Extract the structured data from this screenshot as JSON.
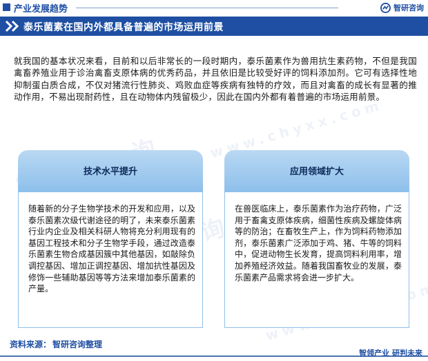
{
  "header": {
    "section_title": "产业发展趋势",
    "brand_name": "智研咨询"
  },
  "title_band": {
    "text": "泰乐菌素在国内外都具备普遍的市场运用前景"
  },
  "intro": {
    "text": "就我国的基本状况来看，目前和以后非常长的一段时期内，泰乐菌素作为兽用抗生素药物，不但是我国禽畜养殖业用于诊治禽畜支原体病的优秀药品，并且依旧是比较受好评的饲料添加剂。它可有选择性地抑制蛋白质合成，不仅对猪流行性肺炎、鸡败血症等疾病有独特的疗效，而且对禽畜的成长有显著的推动作用，不易出现耐药性，且在动物体内残留极少，因此在国内外都有着普遍的市场运用前景。"
  },
  "cards": [
    {
      "title": "技术水平提升",
      "text": "随着新的分子生物学技术的开发和应用，以及泰乐菌素次级代谢途径的明了，未来泰乐菌素行业内企业及相关科研人物将充分利用现有的基因工程技术和分子生物学手段，通过改造泰乐菌素生物合成基因簇中其他基因，如敲除负调控基因、增加正调控基因、增加抗性基因及修饰一些辅助基因等等方法来增加泰乐菌素的产量。"
    },
    {
      "title": "应用领域扩大",
      "text": "在兽医临床上，泰乐菌素作为治疗药物，广泛用于畜禽支原体疾病，细菌性疾病及螺旋体病等的防治；在畜牧生产上，作为饲料药物添加剂，泰乐菌素广泛添加于鸡、猪、牛等的饲料中，促进动物生长发育，提高饲料利用率，增加养殖经济效益。随着我国畜牧业的发展，泰乐菌素产品需求将会进一步扩大。"
    }
  ],
  "footer": {
    "source_label": "资料来源：",
    "source_name": "智研咨询整理",
    "slogan": "智领产业  研判未来"
  },
  "watermark": {
    "text": "智研咨询",
    "url_text": "www.chyxx.com"
  },
  "colors": {
    "brand_blue": "#1f4fa3",
    "card_head": "#8ec0eb"
  },
  "icons": [
    "square-marker-icon",
    "brand-logo-icon",
    "double-chevron-icon"
  ]
}
